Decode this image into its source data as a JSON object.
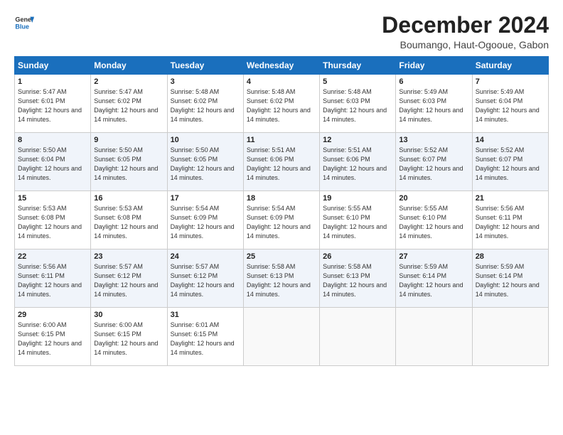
{
  "logo": {
    "line1": "General",
    "line2": "Blue"
  },
  "title": "December 2024",
  "subtitle": "Boumango, Haut-Ogooue, Gabon",
  "days_of_week": [
    "Sunday",
    "Monday",
    "Tuesday",
    "Wednesday",
    "Thursday",
    "Friday",
    "Saturday"
  ],
  "weeks": [
    [
      {
        "day": "1",
        "sunrise": "Sunrise: 5:47 AM",
        "sunset": "Sunset: 6:01 PM",
        "daylight": "Daylight: 12 hours and 14 minutes."
      },
      {
        "day": "2",
        "sunrise": "Sunrise: 5:47 AM",
        "sunset": "Sunset: 6:02 PM",
        "daylight": "Daylight: 12 hours and 14 minutes."
      },
      {
        "day": "3",
        "sunrise": "Sunrise: 5:48 AM",
        "sunset": "Sunset: 6:02 PM",
        "daylight": "Daylight: 12 hours and 14 minutes."
      },
      {
        "day": "4",
        "sunrise": "Sunrise: 5:48 AM",
        "sunset": "Sunset: 6:02 PM",
        "daylight": "Daylight: 12 hours and 14 minutes."
      },
      {
        "day": "5",
        "sunrise": "Sunrise: 5:48 AM",
        "sunset": "Sunset: 6:03 PM",
        "daylight": "Daylight: 12 hours and 14 minutes."
      },
      {
        "day": "6",
        "sunrise": "Sunrise: 5:49 AM",
        "sunset": "Sunset: 6:03 PM",
        "daylight": "Daylight: 12 hours and 14 minutes."
      },
      {
        "day": "7",
        "sunrise": "Sunrise: 5:49 AM",
        "sunset": "Sunset: 6:04 PM",
        "daylight": "Daylight: 12 hours and 14 minutes."
      }
    ],
    [
      {
        "day": "8",
        "sunrise": "Sunrise: 5:50 AM",
        "sunset": "Sunset: 6:04 PM",
        "daylight": "Daylight: 12 hours and 14 minutes."
      },
      {
        "day": "9",
        "sunrise": "Sunrise: 5:50 AM",
        "sunset": "Sunset: 6:05 PM",
        "daylight": "Daylight: 12 hours and 14 minutes."
      },
      {
        "day": "10",
        "sunrise": "Sunrise: 5:50 AM",
        "sunset": "Sunset: 6:05 PM",
        "daylight": "Daylight: 12 hours and 14 minutes."
      },
      {
        "day": "11",
        "sunrise": "Sunrise: 5:51 AM",
        "sunset": "Sunset: 6:06 PM",
        "daylight": "Daylight: 12 hours and 14 minutes."
      },
      {
        "day": "12",
        "sunrise": "Sunrise: 5:51 AM",
        "sunset": "Sunset: 6:06 PM",
        "daylight": "Daylight: 12 hours and 14 minutes."
      },
      {
        "day": "13",
        "sunrise": "Sunrise: 5:52 AM",
        "sunset": "Sunset: 6:07 PM",
        "daylight": "Daylight: 12 hours and 14 minutes."
      },
      {
        "day": "14",
        "sunrise": "Sunrise: 5:52 AM",
        "sunset": "Sunset: 6:07 PM",
        "daylight": "Daylight: 12 hours and 14 minutes."
      }
    ],
    [
      {
        "day": "15",
        "sunrise": "Sunrise: 5:53 AM",
        "sunset": "Sunset: 6:08 PM",
        "daylight": "Daylight: 12 hours and 14 minutes."
      },
      {
        "day": "16",
        "sunrise": "Sunrise: 5:53 AM",
        "sunset": "Sunset: 6:08 PM",
        "daylight": "Daylight: 12 hours and 14 minutes."
      },
      {
        "day": "17",
        "sunrise": "Sunrise: 5:54 AM",
        "sunset": "Sunset: 6:09 PM",
        "daylight": "Daylight: 12 hours and 14 minutes."
      },
      {
        "day": "18",
        "sunrise": "Sunrise: 5:54 AM",
        "sunset": "Sunset: 6:09 PM",
        "daylight": "Daylight: 12 hours and 14 minutes."
      },
      {
        "day": "19",
        "sunrise": "Sunrise: 5:55 AM",
        "sunset": "Sunset: 6:10 PM",
        "daylight": "Daylight: 12 hours and 14 minutes."
      },
      {
        "day": "20",
        "sunrise": "Sunrise: 5:55 AM",
        "sunset": "Sunset: 6:10 PM",
        "daylight": "Daylight: 12 hours and 14 minutes."
      },
      {
        "day": "21",
        "sunrise": "Sunrise: 5:56 AM",
        "sunset": "Sunset: 6:11 PM",
        "daylight": "Daylight: 12 hours and 14 minutes."
      }
    ],
    [
      {
        "day": "22",
        "sunrise": "Sunrise: 5:56 AM",
        "sunset": "Sunset: 6:11 PM",
        "daylight": "Daylight: 12 hours and 14 minutes."
      },
      {
        "day": "23",
        "sunrise": "Sunrise: 5:57 AM",
        "sunset": "Sunset: 6:12 PM",
        "daylight": "Daylight: 12 hours and 14 minutes."
      },
      {
        "day": "24",
        "sunrise": "Sunrise: 5:57 AM",
        "sunset": "Sunset: 6:12 PM",
        "daylight": "Daylight: 12 hours and 14 minutes."
      },
      {
        "day": "25",
        "sunrise": "Sunrise: 5:58 AM",
        "sunset": "Sunset: 6:13 PM",
        "daylight": "Daylight: 12 hours and 14 minutes."
      },
      {
        "day": "26",
        "sunrise": "Sunrise: 5:58 AM",
        "sunset": "Sunset: 6:13 PM",
        "daylight": "Daylight: 12 hours and 14 minutes."
      },
      {
        "day": "27",
        "sunrise": "Sunrise: 5:59 AM",
        "sunset": "Sunset: 6:14 PM",
        "daylight": "Daylight: 12 hours and 14 minutes."
      },
      {
        "day": "28",
        "sunrise": "Sunrise: 5:59 AM",
        "sunset": "Sunset: 6:14 PM",
        "daylight": "Daylight: 12 hours and 14 minutes."
      }
    ],
    [
      {
        "day": "29",
        "sunrise": "Sunrise: 6:00 AM",
        "sunset": "Sunset: 6:15 PM",
        "daylight": "Daylight: 12 hours and 14 minutes."
      },
      {
        "day": "30",
        "sunrise": "Sunrise: 6:00 AM",
        "sunset": "Sunset: 6:15 PM",
        "daylight": "Daylight: 12 hours and 14 minutes."
      },
      {
        "day": "31",
        "sunrise": "Sunrise: 6:01 AM",
        "sunset": "Sunset: 6:15 PM",
        "daylight": "Daylight: 12 hours and 14 minutes."
      },
      null,
      null,
      null,
      null
    ]
  ]
}
